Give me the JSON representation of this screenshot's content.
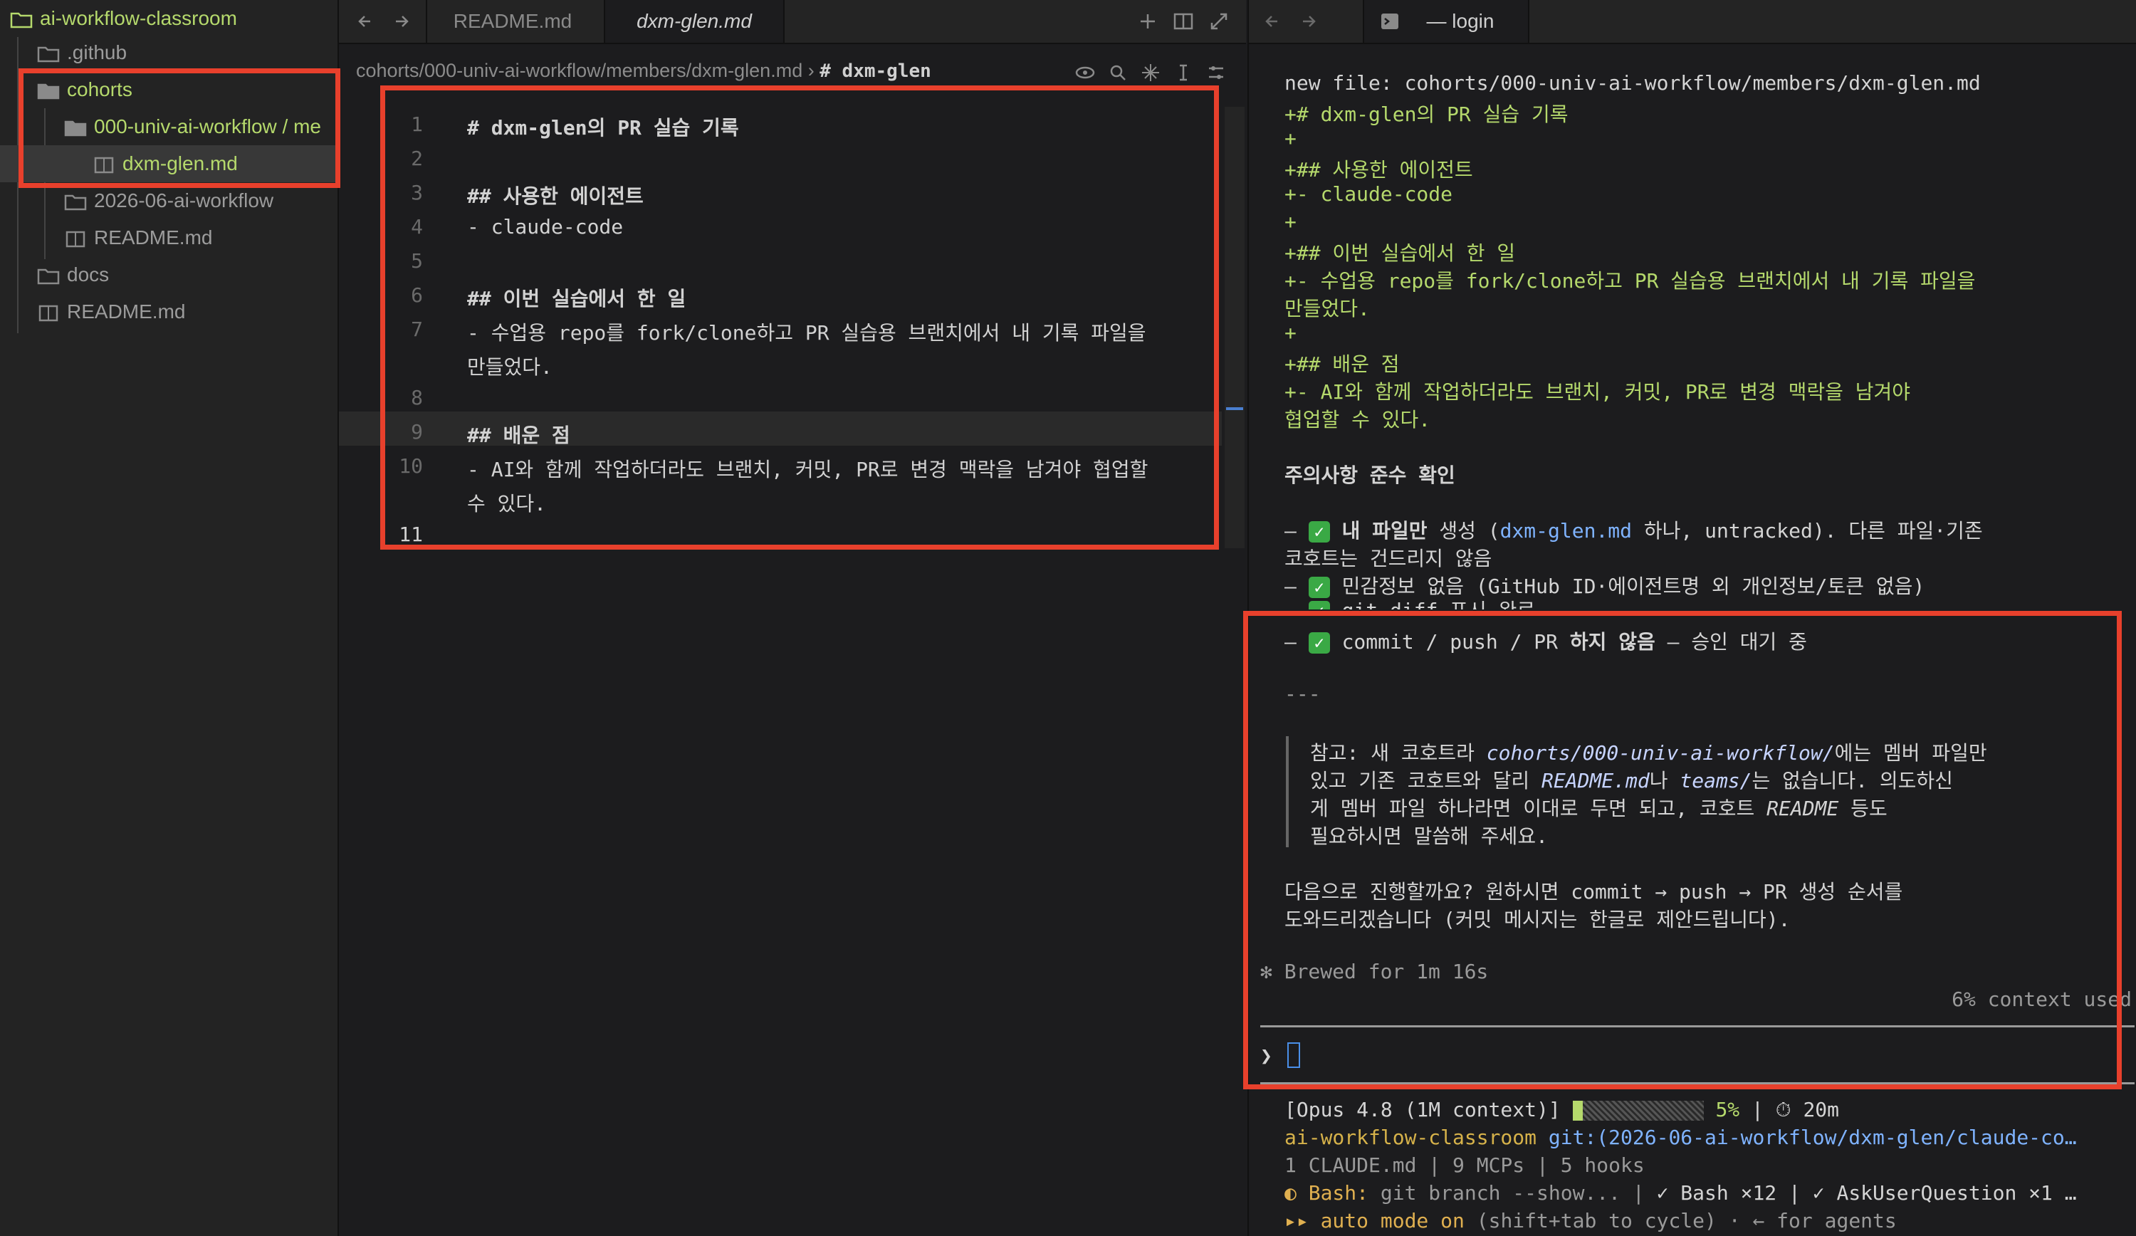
{
  "sidebar": {
    "root": "ai-workflow-classroom",
    "items": [
      {
        "label": ".github"
      },
      {
        "label": "cohorts"
      },
      {
        "label": "000-univ-ai-workflow / me"
      },
      {
        "label": "dxm-glen.md"
      },
      {
        "label": "2026-06-ai-workflow"
      },
      {
        "label": "README.md"
      },
      {
        "label": "docs"
      },
      {
        "label": "README.md"
      }
    ]
  },
  "editor": {
    "tabs": [
      {
        "label": "README.md"
      },
      {
        "label": "dxm-glen.md"
      }
    ],
    "breadcrumb": {
      "path": "cohorts/000-univ-ai-workflow/members/dxm-glen.md",
      "sep": "›",
      "heading": "# dxm-glen"
    },
    "lines": [
      {
        "n": "1",
        "text": "# dxm-glen의 PR 실습 기록"
      },
      {
        "n": "2",
        "text": ""
      },
      {
        "n": "3",
        "text": "## 사용한 에이전트"
      },
      {
        "n": "4",
        "text": "- claude-code"
      },
      {
        "n": "5",
        "text": ""
      },
      {
        "n": "6",
        "text": "## 이번 실습에서 한 일"
      },
      {
        "n": "7",
        "text": "- 수업용 repo를 fork/clone하고 PR 실습용 브랜치에서 내 기록 파일을"
      },
      {
        "n": "",
        "text": "만들었다."
      },
      {
        "n": "8",
        "text": ""
      },
      {
        "n": "9",
        "text": "## 배운 점"
      },
      {
        "n": "10",
        "text": "- AI와 함께 작업하더라도 브랜치, 커밋, PR로 변경 맥락을 남겨야 협업할"
      },
      {
        "n": "",
        "text": "수 있다."
      },
      {
        "n": "11",
        "text": ""
      }
    ]
  },
  "terminal": {
    "tab_label": "— login",
    "lines": {
      "l1": "new file: cohorts/000-univ-ai-workflow/members/dxm-glen.md",
      "l2": "+# dxm-glen의 PR 실습 기록",
      "l3": "+",
      "l4": "+## 사용한 에이전트",
      "l5": "+- claude-code",
      "l6": "+",
      "l7": "+## 이번 실습에서 한 일",
      "l8": "+- 수업용 repo를 fork/clone하고 PR 실습용 브랜치에서 내 기록 파일을",
      "l9": "만들었다.",
      "l10": "+",
      "l11": "+## 배운 점",
      "l12": "+- AI와 함께 작업하더라도 브랜치, 커밋, PR로 변경 맥락을 남겨야",
      "l13": "협업할 수 있다.",
      "heading": "주의사항 준수 확인",
      "c1a": "내 파일만",
      "c1b": " 생성 (",
      "c1c": "dxm-glen.md",
      "c1d": " 하나, untracked). 다른 파일·기존",
      "c1e": "코호트는 건드리지 않음",
      "c2": " 민감정보 없음 (GitHub ID·에이전트명 외 개인정보/토큰 없음)",
      "c3": " git diff 표시 완료",
      "c4a": " commit / push / PR ",
      "c4b": "하지 않음",
      "c4c": " — 승인 대기 중",
      "hr": "---",
      "n1a": "참고: 새 코호트라 ",
      "n1b": "cohorts/000-univ-ai-workflow/",
      "n1c": "에는 멤버 파일만",
      "n2a": "있고 기존 코호트와 달리 ",
      "n2b": "README.md",
      "n2c": "나 ",
      "n2d": "teams/",
      "n2e": "는 없습니다. 의도하신",
      "n3a": "게 멤버 파일 하나라면 이대로 두면 되고, 코호트 ",
      "n3b": "README",
      "n3c": " 등도",
      "n4": "필요하시면 말씀해 주세요.",
      "q1": "다음으로 진행할까요? 원하시면 commit → push → PR 생성 순서를",
      "q2": "도와드리겠습니다 (커밋 메시지는 한글로 제안드립니다).",
      "brewed": "✻ Brewed for 1m 16s",
      "context": "6% context used",
      "prompt": "❯",
      "s1a": "[Opus 4.8 (1M context)]",
      "s1b": "5%",
      "s1c": "|",
      "s1d": "20m",
      "s2a": "ai-workflow-classroom",
      "s2b": " git:(2026-06-ai-workflow/dxm-glen/claude-co…",
      "s3": "1 CLAUDE.md | 9 MCPs | 5 hooks",
      "s4a": "◐ Bash:",
      "s4b": " git branch --show... | ",
      "s4c": "✓ Bash ×12 | ✓ AskUserQuestion ×1 …",
      "s5a": "▸▸ auto mode on",
      "s5b": " (shift+tab to cycle) · ← for agents"
    }
  },
  "colors": {
    "accent_green": "#b5d96c",
    "highlight_box": "#e8402c",
    "check_green": "#3aa945"
  }
}
